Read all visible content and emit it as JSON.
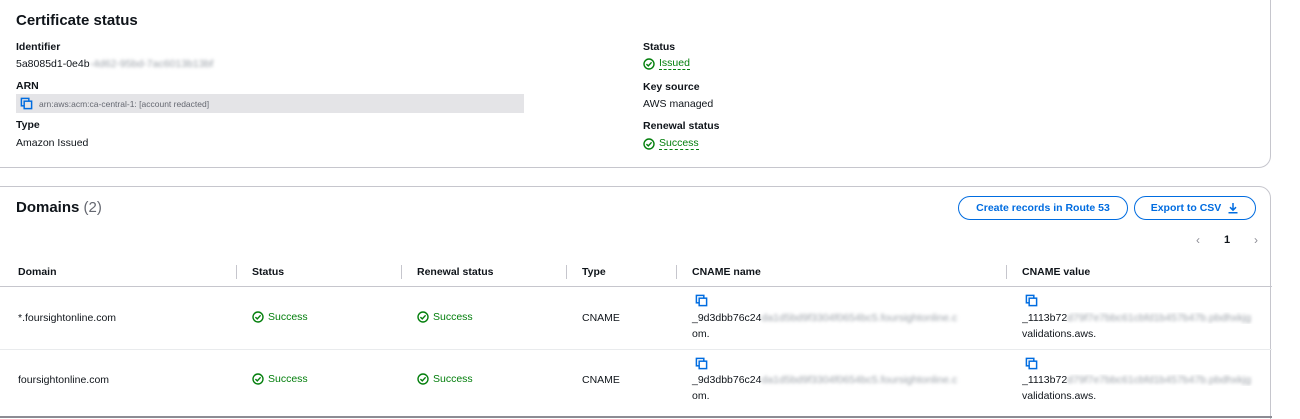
{
  "certificate_status": {
    "title": "Certificate status",
    "identifier_label": "Identifier",
    "identifier_value": "5a8085d1-0e4b",
    "identifier_redacted": "-4d62-95bd-7ac6013b13bf",
    "arn_label": "ARN",
    "arn_value": "arn:aws:acm:ca-central-1: [account redacted]",
    "type_label": "Type",
    "type_value": "Amazon Issued",
    "status_label": "Status",
    "status_value": "Issued",
    "key_source_label": "Key source",
    "key_source_value": "AWS managed",
    "renewal_status_label": "Renewal status",
    "renewal_status_value": "Success"
  },
  "domains": {
    "title": "Domains",
    "count": "(2)",
    "create_records_button": "Create records in Route 53",
    "export_button": "Export to CSV",
    "page_number": "1",
    "columns": [
      "Domain",
      "Status",
      "Renewal status",
      "Type",
      "CNAME name",
      "CNAME value"
    ],
    "rows": [
      {
        "domain": "*.foursightonline.com",
        "status": "Success",
        "renewal_status": "Success",
        "type": "CNAME",
        "cname_name_visible": "_9d3dbb76c24",
        "cname_name_redacted": "da1d5bd9f3304f0654bc5.foursightonline.c",
        "cname_name_end": "om.",
        "cname_value_visible": "_1113b72",
        "cname_value_redacted": "d79f7e7bbc61cbfd1b457b47b.pbdhxkjg",
        "cname_value_end": "validations.aws."
      },
      {
        "domain": "foursightonline.com",
        "status": "Success",
        "renewal_status": "Success",
        "type": "CNAME",
        "cname_name_visible": "_9d3dbb76c24",
        "cname_name_redacted": "da1d5bd9f3304f0654bc5.foursightonline.c",
        "cname_name_end": "om.",
        "cname_value_visible": "_1113b72",
        "cname_value_redacted": "d79f7e7bbc61cbfd1b457b47b.pbdhxkjg",
        "cname_value_end": "validations.aws."
      }
    ]
  },
  "colors": {
    "success": "#037f0c",
    "link": "#006ce0",
    "border": "#c6c6cd"
  }
}
